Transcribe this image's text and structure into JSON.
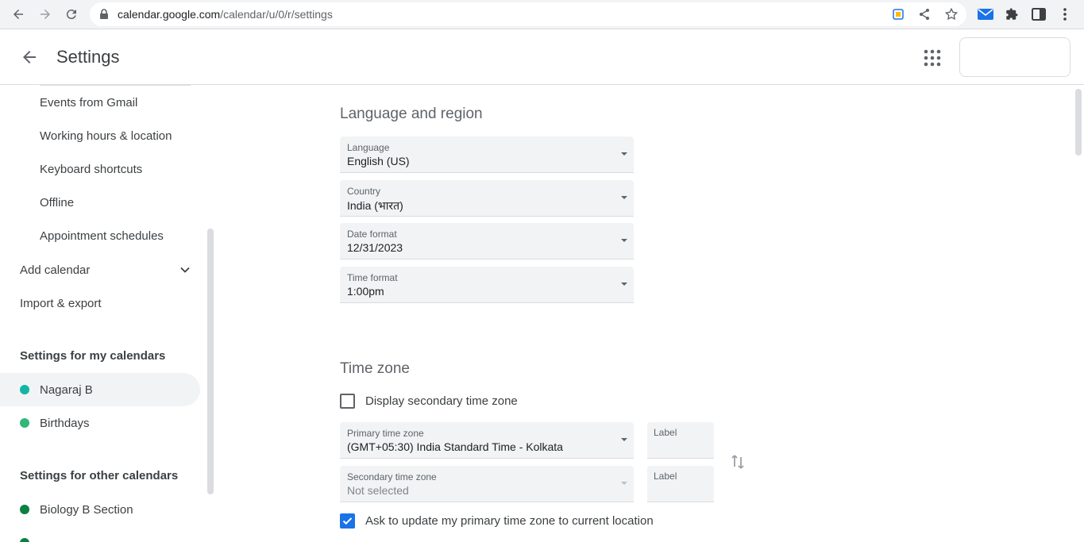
{
  "browser": {
    "url_host": "calendar.google.com",
    "url_path": "/calendar/u/0/r/settings"
  },
  "header": {
    "title": "Settings"
  },
  "sidebar": {
    "items": [
      {
        "label": "Events from Gmail"
      },
      {
        "label": "Working hours & location"
      },
      {
        "label": "Keyboard shortcuts"
      },
      {
        "label": "Offline"
      },
      {
        "label": "Appointment schedules"
      }
    ],
    "add_calendar": "Add calendar",
    "import_export": "Import & export",
    "my_calendars_heading": "Settings for my calendars",
    "my_calendars": [
      {
        "label": "Nagaraj B",
        "color": "#12b5a5"
      },
      {
        "label": "Birthdays",
        "color": "#33b679"
      }
    ],
    "other_calendars_heading": "Settings for other calendars",
    "other_calendars": [
      {
        "label": "Biology B Section",
        "color": "#0b8043"
      }
    ]
  },
  "language_region": {
    "title": "Language and region",
    "language": {
      "label": "Language",
      "value": "English (US)"
    },
    "country": {
      "label": "Country",
      "value": "India (भारत)"
    },
    "date_format": {
      "label": "Date format",
      "value": "12/31/2023"
    },
    "time_format": {
      "label": "Time format",
      "value": "1:00pm"
    }
  },
  "time_zone": {
    "title": "Time zone",
    "secondary_toggle": {
      "label": "Display secondary time zone",
      "checked": false
    },
    "primary": {
      "label": "Primary time zone",
      "value": "(GMT+05:30) India Standard Time - Kolkata"
    },
    "primary_label": {
      "label": "Label"
    },
    "secondary": {
      "label": "Secondary time zone",
      "value": "Not selected"
    },
    "secondary_label": {
      "label": "Label"
    },
    "ask_update": {
      "label": "Ask to update my primary time zone to current location",
      "checked": true
    }
  },
  "colors": {
    "accent": "#1a73e8",
    "selected_bg": "#f1f3f4"
  }
}
